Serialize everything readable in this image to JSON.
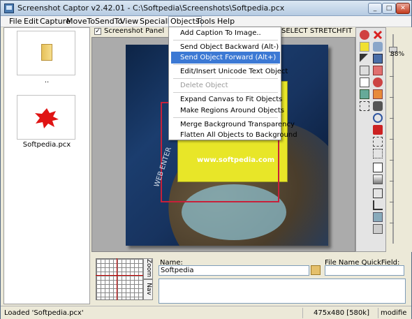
{
  "window": {
    "title": "Screenshot Captor v2.42.01 - C:\\Softpedia\\Screenshots\\Softpedia.pcx",
    "minimize": "_",
    "maximize": "□",
    "close": "✕"
  },
  "menu": [
    "File",
    "Edit",
    "Capture",
    "MoveTo",
    "SendTo",
    "View",
    "SpecialFX",
    "Objects",
    "Tools",
    "Help"
  ],
  "dropdown": {
    "items": [
      {
        "label": "Add Caption To Image..",
        "state": "normal"
      },
      {
        "label": "Send Object Backward  (Alt-)",
        "state": "normal"
      },
      {
        "label": "Send Object Forward  (Alt+)",
        "state": "highlighted"
      },
      {
        "label": "Edit/Insert Unicode Text Object",
        "state": "normal"
      },
      {
        "label": "Delete Object",
        "state": "disabled"
      },
      {
        "label": "Expand Canvas to Fit Objects",
        "state": "normal"
      },
      {
        "label": "Make Regions Around Objects",
        "state": "normal"
      },
      {
        "label": "Merge Background Transparency",
        "state": "normal"
      },
      {
        "label": "Flatten All Objects to Background",
        "state": "normal"
      }
    ]
  },
  "thumbnails": [
    {
      "label": ".."
    },
    {
      "label": "Softpedia.pcx"
    }
  ],
  "preview": {
    "panel_checkbox": "✓",
    "panel_label": "Screenshot Panel",
    "select_label": "SELECT STRETCHFIT",
    "image_text": "www.softpedia.com",
    "image_side_text": "WEB ENTER"
  },
  "zoom": {
    "percent": "88%"
  },
  "toolstrip_icons": [
    "pointer-icon",
    "close-x-icon",
    "highlight-icon",
    "undo-icon",
    "pick-icon",
    "save-icon",
    "image-icon",
    "edit-icon",
    "frame-icon",
    "stamp-icon",
    "region-icon",
    "blur-icon",
    "crop-icon",
    "rotate-icon",
    "rect-icon",
    "zoom-fit-icon",
    "shape-icon"
  ],
  "navigator": {
    "zoom_tab": "Zoom",
    "nav_tab": "Nav"
  },
  "fields": {
    "name_label": "Name:",
    "name_value": "Softpedia",
    "quickfield_label": "File Name QuickField:",
    "quickfield_value": ""
  },
  "status": {
    "message": "Loaded 'Softpedia.pcx'",
    "dimensions": "475x480  [580k]",
    "mode": "modifie"
  },
  "colors": {
    "highlight": "#3c79d4",
    "yellow_overlay": "#e8e628",
    "red_region": "#c8203a"
  }
}
